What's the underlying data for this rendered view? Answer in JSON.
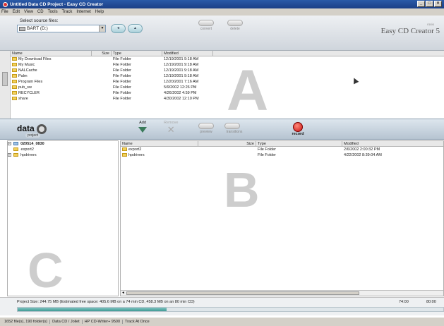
{
  "window": {
    "title": "Untitled Data CD Project - Easy CD Creator",
    "controls": [
      "_",
      "□",
      "×"
    ]
  },
  "menu": [
    "File",
    "Edit",
    "View",
    "CD",
    "Tools",
    "Track",
    "Internet",
    "Help"
  ],
  "source": {
    "label": "Select source files:",
    "drive": "BART (D:)",
    "nav_buttons": [
      "",
      ""
    ],
    "grey_buttons": [
      "convert",
      "delete"
    ],
    "brand": "Easy CD Creator 5",
    "brand_small": "roxio"
  },
  "source_files": {
    "columns": [
      "Name",
      "Size",
      "Type",
      "Modified"
    ],
    "rows": [
      {
        "name": "My Download Files",
        "size": "",
        "type": "File Folder",
        "modified": "12/19/2001 9:18 AM"
      },
      {
        "name": "My Music",
        "size": "",
        "type": "File Folder",
        "modified": "12/19/2001 9:18 AM"
      },
      {
        "name": "NALCache",
        "size": "",
        "type": "File Folder",
        "modified": "12/19/2001 9:18 AM"
      },
      {
        "name": "Palm",
        "size": "",
        "type": "File Folder",
        "modified": "12/19/2001 9:18 AM"
      },
      {
        "name": "Program Files",
        "size": "",
        "type": "File Folder",
        "modified": "12/20/2001 7:16 AM"
      },
      {
        "name": "pub_sw",
        "size": "",
        "type": "File Folder",
        "modified": "5/9/2002 12:26 PM"
      },
      {
        "name": "RECYCLER",
        "size": "",
        "type": "File Folder",
        "modified": "4/26/2002 4:59 PM"
      },
      {
        "name": "share",
        "size": "",
        "type": "File Folder",
        "modified": "4/30/2002 12:10 PM"
      }
    ],
    "watermark": "A"
  },
  "project_toolbar": {
    "logo": "data",
    "logo_sub": "project",
    "add": "Add",
    "remove": "Remove",
    "preview": "preview",
    "transitions": "transitions",
    "record": "record"
  },
  "tree": {
    "root": "020514_0830",
    "children": [
      "export2",
      "hpdrivers"
    ],
    "watermark": "C"
  },
  "project_files": {
    "columns": [
      "Name",
      "Size",
      "Type",
      "Modified"
    ],
    "rows": [
      {
        "name": "export2",
        "size": "",
        "type": "File Folder",
        "modified": "2/6/2002 2:00:32 PM"
      },
      {
        "name": "hpdrivers",
        "size": "",
        "type": "File Folder",
        "modified": "4/22/2002 8:39:04 AM"
      }
    ],
    "watermark": "B"
  },
  "project_size": {
    "text": "Project Size: 244.75 MB   (Estimated free space: 405.6 MB on a 74 min CD,  458.3 MB on an 80 min CD)",
    "mark1": "74:00",
    "mark2": "80:00",
    "fill_fraction": 0.35
  },
  "status": [
    "1652 file(s), 190 folder(s)",
    "Data CD / Joliet",
    "HP CD-Writer+ 9500",
    "Track At Once"
  ]
}
